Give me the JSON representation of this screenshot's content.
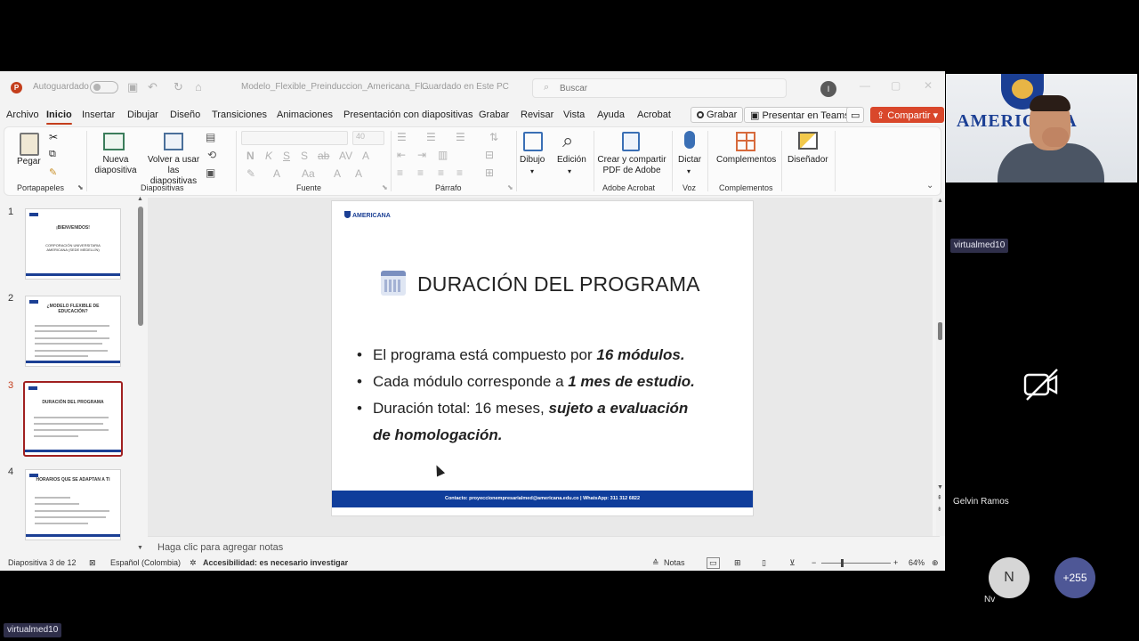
{
  "window": {
    "autosave_label": "Autoguardado",
    "file_name": "Modelo_Flexible_Preinduccion_Americana_Fl...",
    "save_state": "Guardado en Este PC",
    "search_placeholder": "Buscar",
    "profile_initial": "I"
  },
  "menu": {
    "items": [
      "Archivo",
      "Inicio",
      "Insertar",
      "Dibujar",
      "Diseño",
      "Transiciones",
      "Animaciones",
      "Presentación con diapositivas",
      "Grabar",
      "Revisar",
      "Vista",
      "Ayuda",
      "Acrobat"
    ],
    "active": "Inicio",
    "record_label": "Grabar",
    "teams_label": "Presentar en Teams",
    "share_label": "Compartir",
    "accent_color": "#c43e1c"
  },
  "ribbon": {
    "paste_label": "Pegar",
    "new_slide_label": "Nueva diapositiva",
    "reuse_label": "Volver a usar las diapositivas",
    "font_size": "40",
    "drawing_label": "Dibujo",
    "editing_label": "Edición",
    "acrobat_label": "Crear y compartir PDF de Adobe",
    "dictate_label": "Dictar",
    "addins_label": "Complementos",
    "designer_label": "Diseñador",
    "groups": {
      "clipboard": "Portapapeles",
      "slides": "Diapositivas",
      "font": "Fuente",
      "paragraph": "Párrafo",
      "adobe": "Adobe Acrobat",
      "voice": "Voz",
      "addins": "Complementos"
    }
  },
  "thumbnails": [
    {
      "num": "1",
      "title": "¡BIENVENIDOS!",
      "sub": "CORPORACIÓN UNIVERSITARIA AMERICANA (SEDE MEDELLÍN)"
    },
    {
      "num": "2",
      "title": "¿MODELO FLEXIBLE DE EDUCACIÓN?"
    },
    {
      "num": "3",
      "title": "DURACIÓN DEL PROGRAMA"
    },
    {
      "num": "4",
      "title": "HORARIOS QUE SE ADAPTAN A TI"
    }
  ],
  "slide": {
    "logo_text": "AMERICANA",
    "title": "DURACIÓN DEL PROGRAMA",
    "b1_a": "El programa está compuesto por ",
    "b1_b": "16 módulos.",
    "b2_a": "Cada módulo corresponde a ",
    "b2_b": "1 mes de estudio.",
    "b3_a": "Duración total: 16 meses, ",
    "b3_b": "sujeto a evaluación",
    "b3_c": "de homologación.",
    "footer": "Contacto: proyeccionempresarialmed@americana.edu.co | WhatsApp: 311 312 6822",
    "footer_color": "#0f3d9b"
  },
  "notes_placeholder": "Haga clic para agregar notas",
  "status": {
    "slide_of": "Diapositiva 3 de 12",
    "language": "Español (Colombia)",
    "accessibility": "Accesibilidad: es necesario investigar",
    "notes_label": "Notas",
    "zoom": "64%"
  },
  "meeting": {
    "camera_sign": "AMERICANA",
    "presenter_tag": "virtualmed10",
    "participant_name": "Gelvin Ramos",
    "avatar_initial": "N",
    "avatar_sub": "Nv",
    "more_count": "+255",
    "bottom_tag": "virtualmed10"
  }
}
